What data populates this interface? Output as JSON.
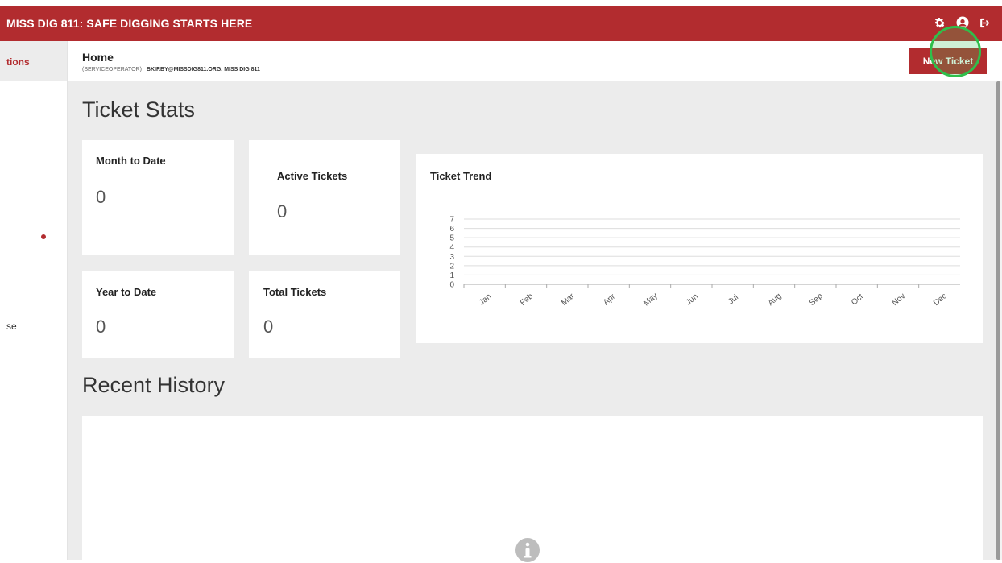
{
  "app": {
    "title": "MISS DIG 811: SAFE DIGGING STARTS HERE"
  },
  "top_icons": [
    "gear-icon",
    "user-icon",
    "logout-icon"
  ],
  "sidebar": {
    "active_label": "tions",
    "partial_label": "se"
  },
  "header": {
    "title": "Home",
    "role": "(SERVICEOPERATOR)",
    "account": "BKIRBY@MISSDIG811.ORG, MISS DIG 811",
    "new_ticket_label": "New Ticket"
  },
  "stats": {
    "section_title": "Ticket Stats",
    "month_to_date": {
      "label": "Month to Date",
      "value": "0"
    },
    "active_tickets": {
      "label": "Active Tickets",
      "value": "0"
    },
    "year_to_date": {
      "label": "Year to Date",
      "value": "0"
    },
    "total_tickets": {
      "label": "Total Tickets",
      "value": "0"
    }
  },
  "chart_data": {
    "type": "line",
    "title": "Ticket Trend",
    "categories": [
      "Jan",
      "Feb",
      "Mar",
      "Apr",
      "May",
      "Jun",
      "Jul",
      "Aug",
      "Sep",
      "Oct",
      "Nov",
      "Dec"
    ],
    "series": [
      {
        "values": [
          0,
          0,
          0,
          0,
          0,
          0,
          0,
          0,
          0,
          0,
          0,
          0
        ]
      }
    ],
    "yticks": [
      "0",
      "1",
      "2",
      "3",
      "4",
      "5",
      "6",
      "7"
    ],
    "ylim": [
      0,
      7
    ],
    "grid": true,
    "xlabel": "",
    "ylabel": "",
    "colors": {
      "grid": "#dddddd",
      "axis": "#aaaaaa",
      "line": "#b22c2f"
    }
  },
  "history": {
    "section_title": "Recent History"
  },
  "colors": {
    "brand": "#b22c2f",
    "background": "#ececec",
    "highlight": "#2fbf4b"
  }
}
